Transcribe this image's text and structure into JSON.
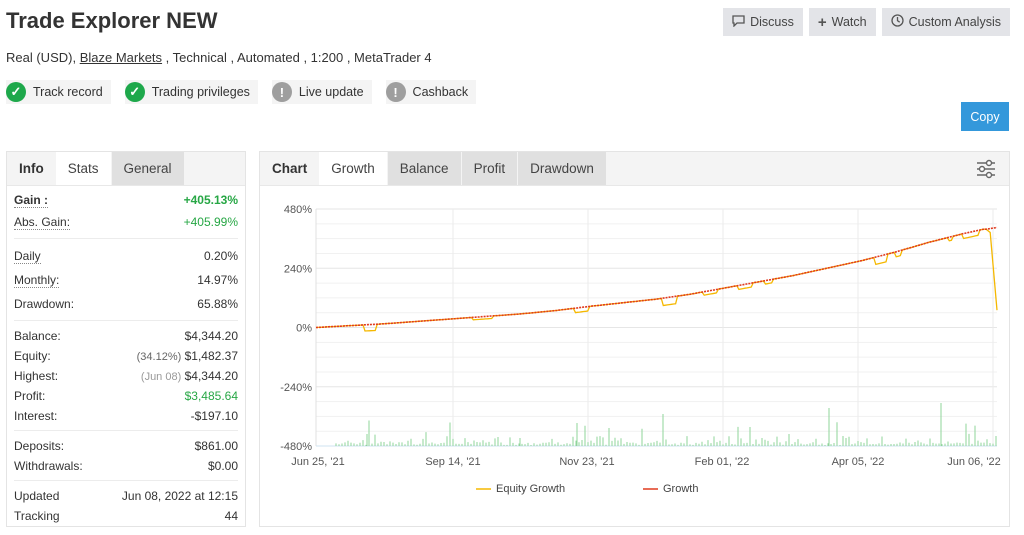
{
  "header": {
    "title": "Trade Explorer NEW",
    "subtitle_prefix": "Real (USD), ",
    "broker_link": "Blaze Markets",
    "subtitle_suffix": " , Technical , Automated , 1:200 , MetaTrader 4"
  },
  "badges": [
    {
      "label": "Track record",
      "status": "ok",
      "icon": "check-icon"
    },
    {
      "label": "Trading privileges",
      "status": "ok",
      "icon": "check-icon"
    },
    {
      "label": "Live update",
      "status": "warn",
      "icon": "exclamation-icon"
    },
    {
      "label": "Cashback",
      "status": "warn",
      "icon": "exclamation-icon"
    }
  ],
  "toolbar": {
    "discuss_label": "Discuss",
    "watch_label": "Watch",
    "custom_analysis_label": "Custom Analysis",
    "copy_label": "Copy"
  },
  "left_panel": {
    "tabs": [
      "Info",
      "Stats",
      "General"
    ],
    "gain_label": "Gain :",
    "gain_value": "+405.13%",
    "abs_gain_label": "Abs. Gain:",
    "abs_gain_value": "+405.99%",
    "daily_label": "Daily",
    "daily_value": "0.20%",
    "monthly_label": "Monthly:",
    "monthly_value": "14.97%",
    "drawdown_label": "Drawdown:",
    "drawdown_value": "65.88%",
    "balance_label": "Balance:",
    "balance_value": "$4,344.20",
    "equity_label": "Equity:",
    "equity_pct": "(34.12%)",
    "equity_value": "$1,482.37",
    "highest_label": "Highest:",
    "highest_date": "(Jun 08)",
    "highest_value": "$4,344.20",
    "profit_label": "Profit:",
    "profit_value": "$3,485.64",
    "interest_label": "Interest:",
    "interest_value": "-$197.10",
    "deposits_label": "Deposits:",
    "deposits_value": "$861.00",
    "withdrawals_label": "Withdrawals:",
    "withdrawals_value": "$0.00",
    "updated_label": "Updated",
    "updated_value": "Jun 08, 2022 at 12:15",
    "tracking_label": "Tracking",
    "tracking_value": "44"
  },
  "right_panel": {
    "tabs": [
      "Chart",
      "Growth",
      "Balance",
      "Profit",
      "Drawdown"
    ]
  },
  "chart_data": {
    "type": "line",
    "title": "",
    "xlabel": "",
    "ylabel": "",
    "ylim": [
      -480,
      480
    ],
    "yticks": [
      "480%",
      "240%",
      "0%",
      "-240%",
      "-480%"
    ],
    "ytick_values": [
      480,
      240,
      0,
      -240,
      -480
    ],
    "xticks": [
      "Jun 25, '21",
      "Sep 14, '21",
      "Nov 23, '21",
      "Feb 01, '22",
      "Apr 05, '22",
      "Jun 06, '22"
    ],
    "grid": true,
    "legend_position": "bottom",
    "colors": {
      "equity": "#f5b800",
      "growth": "#e03a1e",
      "volume": "#8fd49a"
    },
    "x_progress": [
      0,
      0.1,
      0.2,
      0.25,
      0.3,
      0.35,
      0.4,
      0.45,
      0.5,
      0.55,
      0.6,
      0.65,
      0.7,
      0.75,
      0.8,
      0.85,
      0.9,
      0.95,
      0.98,
      1.0
    ],
    "series": [
      {
        "name": "Equity Growth",
        "values": [
          0,
          10,
          30,
          40,
          50,
          62,
          80,
          95,
          110,
          130,
          155,
          180,
          205,
          235,
          265,
          300,
          340,
          370,
          390,
          70
        ]
      },
      {
        "name": "Growth",
        "values": [
          0,
          15,
          35,
          45,
          55,
          68,
          85,
          100,
          115,
          135,
          160,
          185,
          210,
          240,
          270,
          305,
          345,
          380,
          398,
          405
        ]
      }
    ],
    "legend": [
      "Equity Growth",
      "Growth"
    ]
  }
}
